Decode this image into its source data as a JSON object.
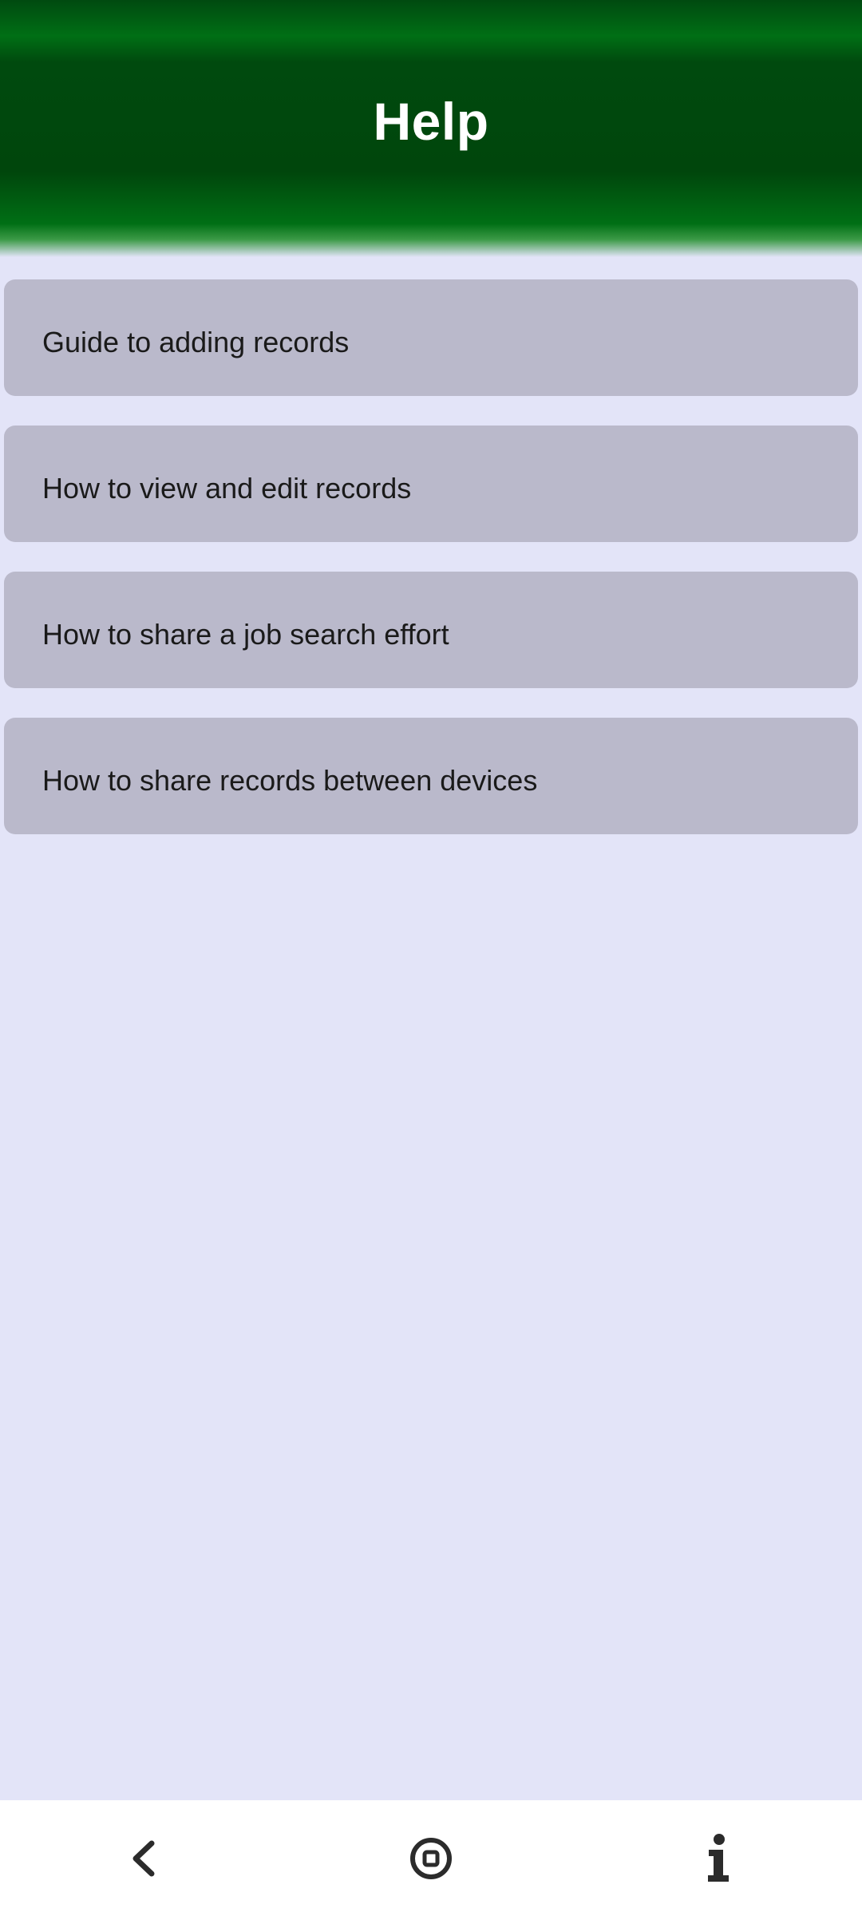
{
  "header": {
    "title": "Help"
  },
  "help_items": [
    {
      "label": "Guide to adding records"
    },
    {
      "label": "How to view and edit records"
    },
    {
      "label": "How to share a job search effort"
    },
    {
      "label": "How to share records between devices"
    }
  ],
  "navbar": {
    "icons": [
      "back-chevron-icon",
      "home-circle-icon",
      "info-icon"
    ]
  },
  "colors": {
    "header_green": "#00460c",
    "background": "#e3e4f8",
    "item_background": "#bab9cb",
    "navbar_background": "#ffffff"
  }
}
